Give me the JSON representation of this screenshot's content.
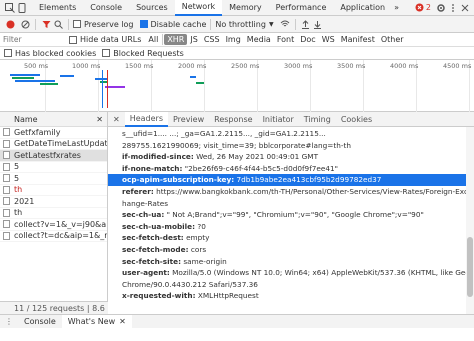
{
  "top_tabs": [
    {
      "label": "Elements"
    },
    {
      "label": "Console"
    },
    {
      "label": "Sources"
    },
    {
      "label": "Network"
    },
    {
      "label": "Memory"
    },
    {
      "label": "Performance"
    },
    {
      "label": "Application"
    }
  ],
  "active_top_tab": "Network",
  "more_tabs_label": "»",
  "error_count": "2",
  "toolbar": {
    "preserve_log": "Preserve log",
    "disable_cache": "Disable cache",
    "throttling": "No throttling"
  },
  "filter": {
    "placeholder": "Filter",
    "hide_data_urls": "Hide data URLs",
    "types": [
      "All",
      "XHR",
      "JS",
      "CSS",
      "Img",
      "Media",
      "Font",
      "Doc",
      "WS",
      "Manifest",
      "Other"
    ],
    "active_type": "XHR"
  },
  "blocked": {
    "has_blocked_cookies": "Has blocked cookies",
    "blocked_requests": "Blocked Requests"
  },
  "timeline": {
    "ticks": [
      "500 ms",
      "1000 ms",
      "1500 ms",
      "2000 ms",
      "2500 ms",
      "3000 ms",
      "3500 ms",
      "4000 ms",
      "4500 ms"
    ]
  },
  "request_list": {
    "header": "Name",
    "items": [
      {
        "name": "Getfxfamily",
        "selected": false,
        "red": false
      },
      {
        "name": "GetDateTimeLastUpdate",
        "selected": false,
        "red": false
      },
      {
        "name": "GetLatestfxrates",
        "selected": true,
        "red": false
      },
      {
        "name": "5",
        "selected": false,
        "red": false
      },
      {
        "name": "5",
        "selected": false,
        "red": false
      },
      {
        "name": "th",
        "selected": false,
        "red": true
      },
      {
        "name": "2021",
        "selected": false,
        "red": false
      },
      {
        "name": "th",
        "selected": false,
        "red": false
      },
      {
        "name": "collect?v=1&_v=j90&a",
        "selected": false,
        "red": false
      },
      {
        "name": "collect?t=dc&aip=1&_r=3&",
        "selected": false,
        "red": false
      }
    ],
    "footer": "11 / 125 requests  |  8.6 kB /"
  },
  "detail_tabs": [
    "Headers",
    "Preview",
    "Response",
    "Initiator",
    "Timing",
    "Cookies"
  ],
  "active_detail_tab": "Headers",
  "headers": [
    {
      "k": "",
      "v": "s__ufid=1.... ...; _ga=GA1.2.2115..., _gid=GA1.2.2115..."
    },
    {
      "k": "",
      "v": "289755.1621990069; visit_time=39; bblcorporate#lang=th-th"
    },
    {
      "k": "if-modified-since:",
      "v": "Wed, 26 May 2021 00:49:01 GMT"
    },
    {
      "k": "if-none-match:",
      "v": "\"2be26f69-c46f-4f44-b5c5-d0d0f9f7ee41\""
    },
    {
      "k": "ocp-apim-subscription-key:",
      "v": "7db1b9abe2ea413cbf95b2d99782ed37",
      "sel": true
    },
    {
      "k": "referer:",
      "v": "https://www.bangkokbank.com/th-TH/Personal/Other-Services/View-Rates/Foreign-Exc"
    },
    {
      "k": "",
      "v": "hange-Rates"
    },
    {
      "k": "sec-ch-ua:",
      "v": "\" Not A;Brand\";v=\"99\", \"Chromium\";v=\"90\", \"Google Chrome\";v=\"90\""
    },
    {
      "k": "sec-ch-ua-mobile:",
      "v": "?0"
    },
    {
      "k": "sec-fetch-dest:",
      "v": "empty"
    },
    {
      "k": "sec-fetch-mode:",
      "v": "cors"
    },
    {
      "k": "sec-fetch-site:",
      "v": "same-origin"
    },
    {
      "k": "user-agent:",
      "v": "Mozilla/5.0 (Windows NT 10.0; Win64; x64) AppleWebKit/537.36 (KHTML, like Gecko)"
    },
    {
      "k": "",
      "v": "Chrome/90.0.4430.212 Safari/537.36"
    },
    {
      "k": "x-requested-with:",
      "v": "XMLHttpRequest"
    }
  ],
  "bottom_tabs": [
    "Console",
    "What's New"
  ],
  "active_bottom_tab": "What's New",
  "colors": {
    "accent": "#1a73e8",
    "error": "#d93025"
  }
}
